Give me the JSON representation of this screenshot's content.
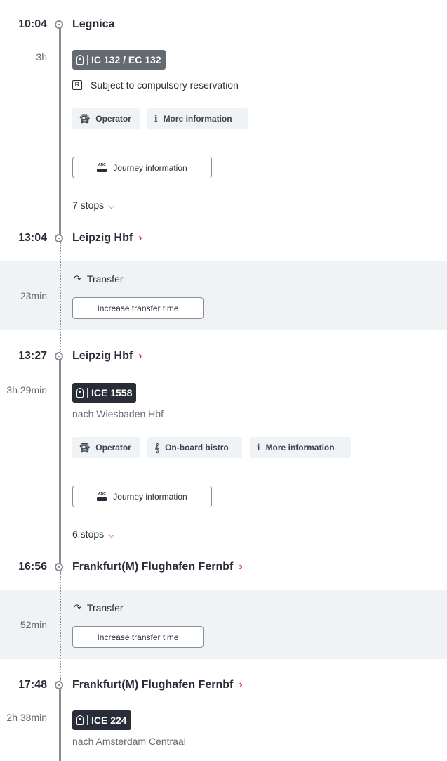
{
  "legs": [
    {
      "dep_time": "10:04",
      "dep_station": "Legnica",
      "duration": "3h",
      "train": "IC 132 / EC 132",
      "reservation": "Subject to compulsory reservation",
      "chips": [
        "Operator",
        "More information"
      ],
      "journey_info": "Journey information",
      "stops": "7 stops",
      "arr_time": "13:04",
      "arr_station": "Leipzig Hbf"
    },
    {
      "dep_time": "13:27",
      "dep_station": "Leipzig Hbf",
      "duration": "3h 29min",
      "train": "ICE 1558",
      "destination": "nach Wiesbaden Hbf",
      "chips": [
        "Operator",
        "On-board bistro",
        "More information"
      ],
      "journey_info": "Journey information",
      "stops": "6 stops",
      "arr_time": "16:56",
      "arr_station": "Frankfurt(M) Flughafen Fernbf"
    },
    {
      "dep_time": "17:48",
      "dep_station": "Frankfurt(M) Flughafen Fernbf",
      "duration": "2h 38min",
      "train": "ICE 224",
      "destination": "nach Amsterdam Centraal"
    }
  ],
  "transfers": [
    {
      "label": "Transfer",
      "duration": "23min",
      "button": "Increase transfer time"
    },
    {
      "label": "Transfer",
      "duration": "52min",
      "button": "Increase transfer time"
    }
  ],
  "icons": {
    "train": "train-icon",
    "reservation": "reservation-r-icon",
    "operator": "bus-operator-icon",
    "info": "info-i-icon",
    "bistro": "fork-knife-icon",
    "journey": "abc-train-icon",
    "chevron_right": "chevron-right-icon",
    "chevron_down": "chevron-down-icon",
    "transfer": "transfer-arrow-icon"
  },
  "colors": {
    "accent": "#c0392b",
    "badge_grey": "#646973",
    "badge_dark": "#282d37",
    "band": "#f0f3f5"
  }
}
